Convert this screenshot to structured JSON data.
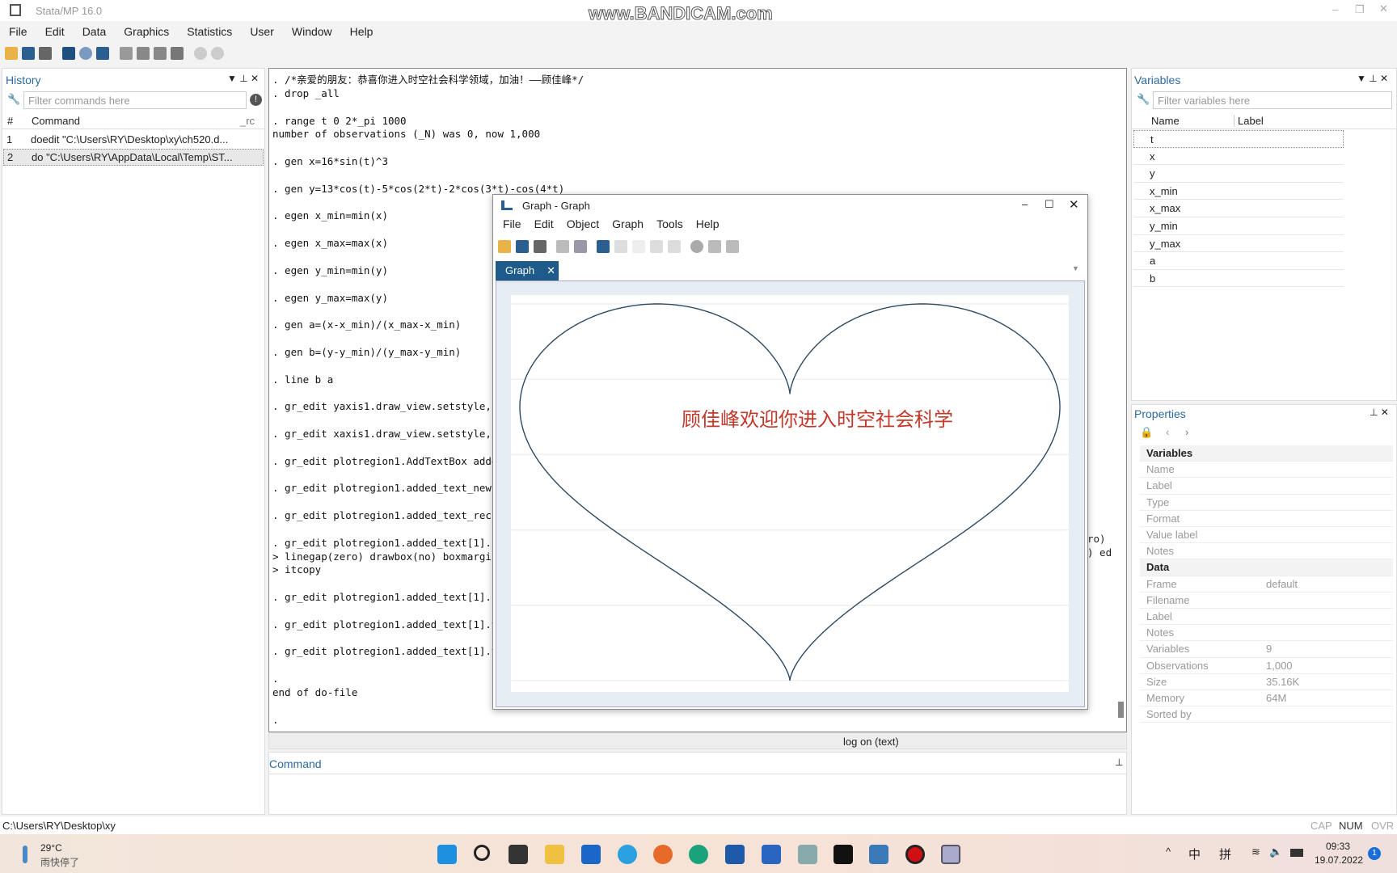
{
  "app": {
    "title": "Stata/MP 16.0",
    "watermark": "www.BANDICAM.com"
  },
  "menu": [
    "File",
    "Edit",
    "Data",
    "Graphics",
    "Statistics",
    "User",
    "Window",
    "Help"
  ],
  "history": {
    "title": "History",
    "filter_placeholder": "Filter commands here",
    "col_num": "#",
    "col_cmd": "Command",
    "col_rc": "_rc",
    "items": [
      {
        "n": "1",
        "cmd": "doedit \"C:\\Users\\RY\\Desktop\\xy\\ch520.d..."
      },
      {
        "n": "2",
        "cmd": "do \"C:\\Users\\RY\\AppData\\Local\\Temp\\ST..."
      }
    ]
  },
  "console": {
    "lines": [
      ". /*亲爱的朋友：恭喜你进入时空社会科学领域，加油！——顾佳峰*/",
      ". drop _all",
      "",
      ". range t 0 2*_pi 1000",
      "number of observations (_N) was 0, now 1,000",
      "",
      ". gen x=16*sin(t)^3",
      "",
      ". gen y=13*cos(t)-5*cos(2*t)-2*cos(3*t)-cos(4*t)",
      "",
      ". egen x_min=min(x)",
      "",
      ". egen x_max=max(x)",
      "",
      ". egen y_min=min(y)",
      "",
      ". egen y_max=max(y)",
      "",
      ". gen a=(x-x_min)/(x_max-x_min)",
      "",
      ". gen b=(y-y_min)/(y_max-y_min)",
      "",
      ". line b a",
      "",
      ". gr_edit yaxis1.draw_view.setstyle,",
      "",
      ". gr_edit xaxis1.draw_view.setstyle,",
      "",
      ". gr_edit plotregion1.AddTextBox adde",
      "",
      ". gr_edit plotregion1.added_text_new",
      "",
      ". gr_edit plotregion1.added_text_rec",
      "",
      ". gr_edit plotregion1.added_text[1].s",
      "> linegap(zero) drawbox(no) boxmargin",
      "> itcopy",
      "",
      ". gr_edit plotregion1.added_text[1].s",
      "",
      ". gr_edit plotregion1.added_text[1].t",
      "",
      ". gr_edit plotregion1.added_text[1].t",
      "",
      ".",
      "end of do-file",
      "",
      "."
    ],
    "right_fragments": [
      "ro)",
      ") ed"
    ],
    "status": "log on (text)"
  },
  "command": {
    "title": "Command"
  },
  "variables": {
    "title": "Variables",
    "filter_placeholder": "Filter variables here",
    "col_name": "Name",
    "col_label": "Label",
    "items": [
      "t",
      "x",
      "y",
      "x_min",
      "x_max",
      "y_min",
      "y_max",
      "a",
      "b"
    ]
  },
  "properties": {
    "title": "Properties",
    "rows": [
      {
        "k": "Variables",
        "v": "",
        "head": true
      },
      {
        "k": "Name",
        "v": ""
      },
      {
        "k": "Label",
        "v": ""
      },
      {
        "k": "Type",
        "v": ""
      },
      {
        "k": "Format",
        "v": ""
      },
      {
        "k": "Value label",
        "v": ""
      },
      {
        "k": "Notes",
        "v": ""
      },
      {
        "k": "Data",
        "v": "",
        "head": true
      },
      {
        "k": "Frame",
        "v": "default"
      },
      {
        "k": "Filename",
        "v": ""
      },
      {
        "k": "Label",
        "v": ""
      },
      {
        "k": "Notes",
        "v": ""
      },
      {
        "k": "Variables",
        "v": "9"
      },
      {
        "k": "Observations",
        "v": "1,000"
      },
      {
        "k": "Size",
        "v": "35.16K"
      },
      {
        "k": "Memory",
        "v": "64M"
      },
      {
        "k": "Sorted by",
        "v": ""
      }
    ]
  },
  "statusbar": {
    "path": "C:\\Users\\RY\\Desktop\\xy",
    "cap": "CAP",
    "num": "NUM",
    "ovr": "OVR"
  },
  "graph": {
    "title": "Graph - Graph",
    "menu": [
      "File",
      "Edit",
      "Object",
      "Graph",
      "Tools",
      "Help"
    ],
    "tab": "Graph",
    "text": "顾佳峰欢迎你进入时空社会科学",
    "text_color": "#c0392b",
    "line_color": "#2e4a62"
  },
  "chart_data": {
    "type": "line",
    "x_var": "a",
    "y_var": "b",
    "x_formula": "x=16*sin(t)^3",
    "y_formula": "y=13*cos(t)-5*cos(2*t)-2*cos(3*t)-cos(4*t)",
    "t_range": [
      0,
      6.2832
    ],
    "n": 1000,
    "xlim": [
      0,
      1
    ],
    "ylim": [
      0,
      1
    ],
    "grid": "horizontal",
    "axes_visible": false,
    "annotation": "顾佳峰欢迎你进入时空社会科学"
  },
  "taskbar": {
    "weather_temp": "29°C",
    "weather_text": "雨快停了",
    "ime1": "中",
    "ime2": "拼",
    "time": "09:33",
    "date": "19.07.2022",
    "notif": "1"
  }
}
